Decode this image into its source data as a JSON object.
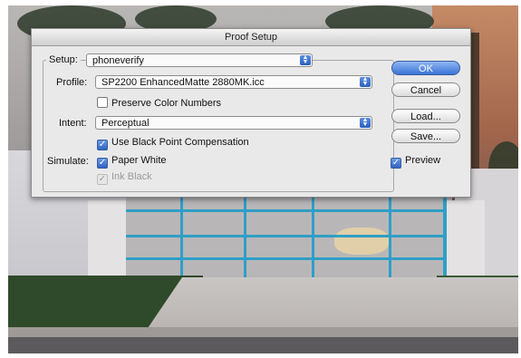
{
  "dialog": {
    "title": "Proof Setup",
    "setup": {
      "label": "Setup:",
      "value": "phoneverify"
    },
    "profile": {
      "label": "Profile:",
      "value": "SP2200 EnhancedMatte 2880MK.icc"
    },
    "preserve_color_numbers": {
      "label": "Preserve Color Numbers",
      "checked": false
    },
    "intent": {
      "label": "Intent:",
      "value": "Perceptual"
    },
    "black_point": {
      "label": "Use Black Point Compensation",
      "checked": true
    },
    "simulate": {
      "label": "Simulate:",
      "paper_white": {
        "label": "Paper White",
        "checked": true
      },
      "ink_black": {
        "label": "Ink Black",
        "checked": true,
        "disabled": true
      }
    },
    "buttons": {
      "ok": "OK",
      "cancel": "Cancel",
      "load": "Load...",
      "save": "Save..."
    },
    "preview": {
      "label": "Preview",
      "checked": true
    }
  },
  "icons": {
    "popup_arrows": "up-down-chevrons-icon",
    "check": "checkmark-icon"
  },
  "colors": {
    "default_button": "#3a74d6",
    "gate": "#2f9fc6"
  }
}
